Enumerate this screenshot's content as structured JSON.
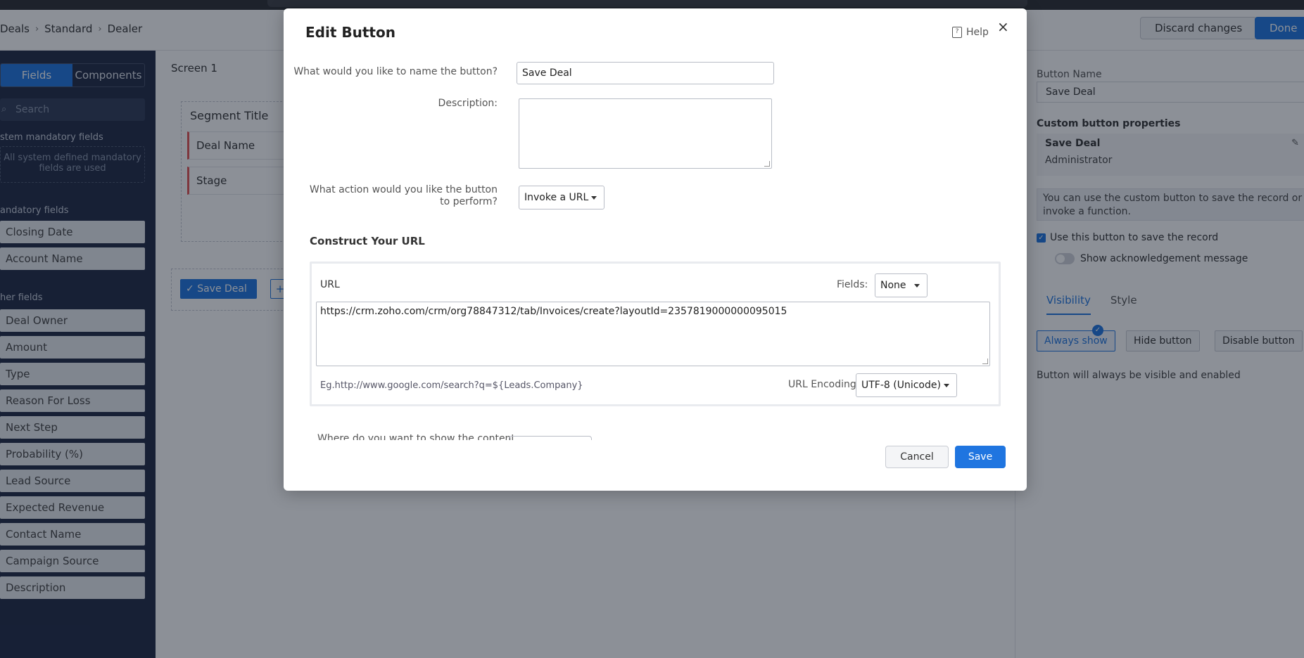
{
  "breadcrumb": [
    "Deals",
    "Standard",
    "Dealer"
  ],
  "topbar": {
    "discard_label": "Discard changes",
    "done_label": "Done"
  },
  "leftnav": {
    "tabs": [
      "Fields",
      "Components"
    ],
    "search_placeholder": "Search",
    "system_section": "stem mandatory fields",
    "system_note": "All system defined mandatory fields are used",
    "mandatory_section": "andatory fields",
    "mandatory_fields": [
      "Closing Date",
      "Account Name"
    ],
    "other_section": "her fields",
    "other_fields": [
      "Deal Owner",
      "Amount",
      "Type",
      "Reason For Loss",
      "Next Step",
      "Probability (%)",
      "Lead Source",
      "Expected Revenue",
      "Contact Name",
      "Campaign Source",
      "Description"
    ]
  },
  "canvas": {
    "screen_label": "Screen 1",
    "segment_title": "Segment Title",
    "segment_fields": [
      "Deal Name",
      "Stage"
    ],
    "save_button": "Save Deal"
  },
  "rightpanel": {
    "button_name_label": "Button Name",
    "button_name_value": "Save Deal",
    "props_heading": "Custom button properties",
    "card_name": "Save Deal",
    "card_role": "Administrator",
    "info": "You can use the custom button to save the record or invoke a function.",
    "checkbox_label": "Use this button to save the record",
    "toggle_label": "Show acknowledgement message",
    "tabs": [
      "Visibility",
      "Style"
    ],
    "visibility_buttons": [
      "Always show",
      "Hide button",
      "Disable button"
    ],
    "note": "Button will always be visible and enabled"
  },
  "modal": {
    "title": "Edit Button",
    "help": "Help",
    "name_question": "What would you like to name the button?",
    "name_value": "Save Deal",
    "description_label": "Description:",
    "action_question": "What action would you like the button to perform?",
    "action_value": "Invoke a URL",
    "construct_title": "Construct Your URL",
    "url_label": "URL",
    "fields_label": "Fields:",
    "fields_value": "None",
    "url_value": "https://crm.zoho.com/crm/org78847312/tab/Invoices/create?layoutId=2357819000000095015",
    "example": "Eg.http://www.google.com/search?q=${Leads.Company}",
    "encoding_label": "URL Encoding:",
    "encoding_value": "UTF-8 (Unicode)",
    "partial_question": "Where do you want to show the content",
    "cancel": "Cancel",
    "save": "Save"
  },
  "colors": {
    "accent": "#1f75e0",
    "nav_bg": "#1f2a44",
    "required_marker": "#e55353"
  }
}
